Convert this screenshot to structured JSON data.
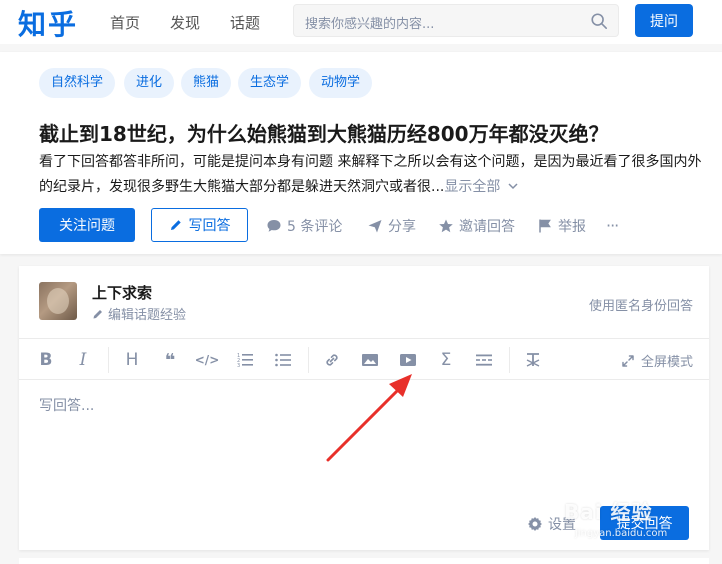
{
  "header": {
    "logo": "知乎",
    "nav": [
      "首页",
      "发现",
      "话题"
    ],
    "search_placeholder": "搜索你感兴趣的内容...",
    "ask_label": "提问"
  },
  "question": {
    "topics": [
      "自然科学",
      "进化",
      "熊猫",
      "生态学",
      "动物学"
    ],
    "title": "截止到18世纪，为什么始熊猫到大熊猫历经800万年都没灭绝？",
    "description": "看了下回答都答非所问，可能是提问本身有问题 来解释下之所以会有这个问题，是因为最近看了很多国内外的纪录片，发现很多野生大熊猫大部分都是躲进天然洞穴或者很...",
    "show_all": "显示全部",
    "follow_label": "关注问题",
    "write_label": "写回答",
    "actions": {
      "comments": "5 条评论",
      "share": "分享",
      "invite": "邀请回答",
      "report": "举报",
      "more": "···"
    }
  },
  "editor": {
    "user_name": "上下求索",
    "edit_experience": "编辑话题经验",
    "anonymous": "使用匿名身份回答",
    "toolbar": {
      "bold": "B",
      "italic": "I",
      "heading": "H",
      "quote": "❝",
      "code": "</>",
      "formula": "Σ",
      "fullscreen": "全屏模式"
    },
    "placeholder": "写回答...",
    "settings": "设置",
    "submit": "提交回答"
  },
  "watermark": {
    "text": "Bai 经验",
    "sub": "jingyan.baidu.com"
  },
  "colors": {
    "brand": "#0a6de0",
    "tag_bg": "#e9f2fd",
    "muted": "#8590a6",
    "annotation": "#e8302a"
  }
}
